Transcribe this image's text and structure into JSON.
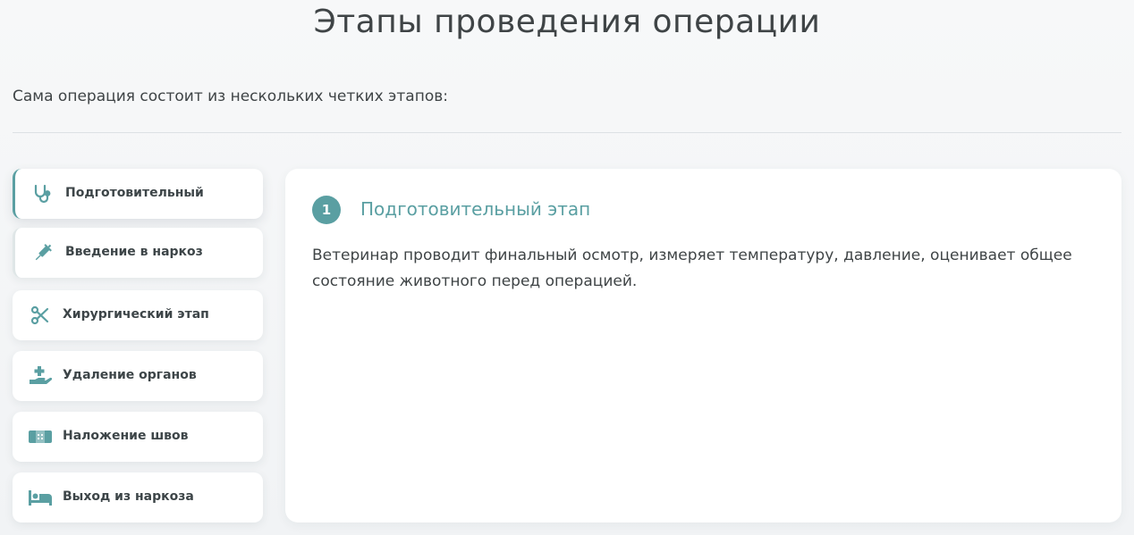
{
  "header": {
    "title": "Этапы проведения операции",
    "intro": "Сама операция состоит из нескольких четких этапов:"
  },
  "colors": {
    "accent": "#5a9fa2",
    "text": "#3f4446",
    "panel_bg": "#ffffff",
    "page_bg": "#f3f5f6"
  },
  "tabs": [
    {
      "label": "Подготовительный",
      "icon": "stethoscope-icon",
      "state": "active"
    },
    {
      "label": "Введение в наркоз",
      "icon": "syringe-icon",
      "state": "hovered"
    },
    {
      "label": "Хирургический этап",
      "icon": "scissors-icon",
      "state": "default"
    },
    {
      "label": "Удаление органов",
      "icon": "hand-medical-icon",
      "state": "default"
    },
    {
      "label": "Наложение швов",
      "icon": "bandage-icon",
      "state": "default"
    },
    {
      "label": "Выход из наркоза",
      "icon": "bed-icon",
      "state": "default"
    }
  ],
  "content": {
    "step_number": "1",
    "step_title": "Подготовительный этап",
    "step_text": "Ветеринар проводит финальный осмотр, измеряет температуру, давление, оценивает общее состояние животного перед операцией."
  }
}
